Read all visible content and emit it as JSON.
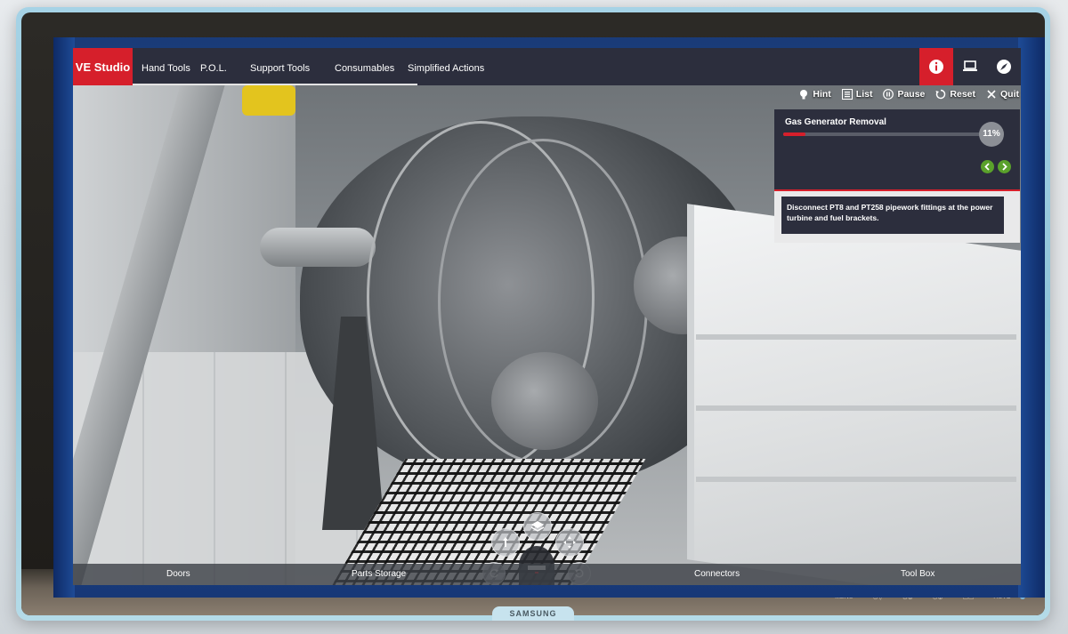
{
  "app": {
    "logo": "VE Studio"
  },
  "nav": {
    "items": [
      {
        "label": "Hand Tools"
      },
      {
        "label": "P.O.L."
      },
      {
        "label": "Support Tools"
      },
      {
        "label": "Consumables"
      },
      {
        "label": "Simplified Actions"
      }
    ]
  },
  "top_right": {
    "icons": [
      "info-icon",
      "laptop-icon",
      "compass-icon"
    ]
  },
  "actions": {
    "hint": "Hint",
    "list": "List",
    "pause": "Pause",
    "reset": "Reset",
    "quit": "Quit"
  },
  "task": {
    "title": "Gas Generator Removal",
    "progress_percent": 11,
    "progress_label": "11%"
  },
  "instruction": {
    "text": "Disconnect PT8 and PT258 pipework fittings at the power turbine and fuel brackets."
  },
  "bottom_bar": {
    "doors": "Doors",
    "parts_storage": "Parts Storage",
    "connectors": "Connectors",
    "tool_box": "Tool Box"
  },
  "monitor": {
    "brand": "SAMSUNG",
    "controls": [
      "MENU",
      "⊙▽",
      "⊖⊕",
      "⊙⊕",
      "▭▭",
      "AUTO"
    ]
  },
  "colors": {
    "accent": "#d61f2b",
    "panel": "#2c2e3d",
    "nav_arrow": "#5aa12b"
  }
}
